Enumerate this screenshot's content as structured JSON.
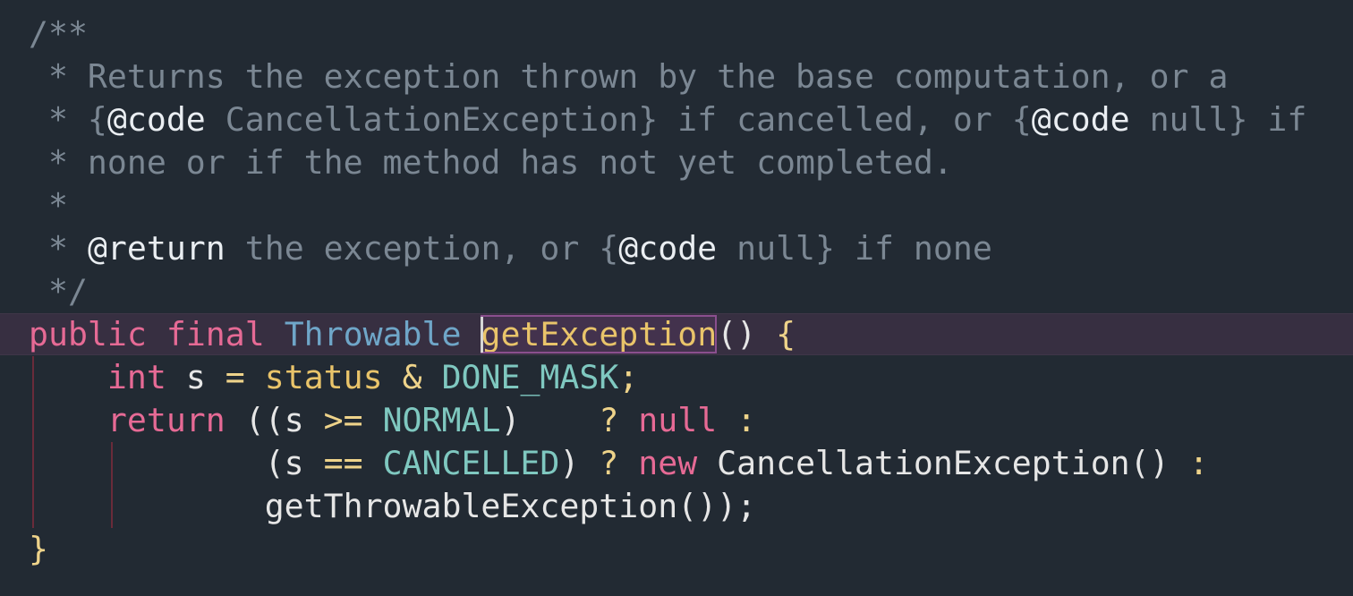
{
  "editor": {
    "lines": [
      {
        "tokens": [
          {
            "t": "/**",
            "c": "c"
          }
        ]
      },
      {
        "tokens": [
          {
            "t": " * Returns the exception thrown by the base computation, or a",
            "c": "c"
          }
        ]
      },
      {
        "tokens": [
          {
            "t": " * {",
            "c": "c"
          },
          {
            "t": "@code",
            "c": "tag"
          },
          {
            "t": " CancellationException} if cancelled, or {",
            "c": "c"
          },
          {
            "t": "@code",
            "c": "tag"
          },
          {
            "t": " null} if",
            "c": "c"
          }
        ]
      },
      {
        "tokens": [
          {
            "t": " * none or if the method has not yet completed.",
            "c": "c"
          }
        ]
      },
      {
        "tokens": [
          {
            "t": " *",
            "c": "c"
          }
        ]
      },
      {
        "tokens": [
          {
            "t": " * ",
            "c": "c"
          },
          {
            "t": "@return",
            "c": "tag"
          },
          {
            "t": " the exception, or {",
            "c": "c"
          },
          {
            "t": "@code",
            "c": "tag"
          },
          {
            "t": " null} if none",
            "c": "c"
          }
        ]
      },
      {
        "tokens": [
          {
            "t": " */",
            "c": "c"
          }
        ]
      },
      {
        "current": true,
        "tokens": [
          {
            "t": "public",
            "c": "kw"
          },
          {
            "t": " ",
            "c": "pl"
          },
          {
            "t": "final",
            "c": "kw"
          },
          {
            "t": " ",
            "c": "pl"
          },
          {
            "t": "Throwable",
            "c": "ty"
          },
          {
            "t": " ",
            "c": "pl"
          },
          {
            "t": "getException",
            "c": "fn",
            "match": true
          },
          {
            "t": "() ",
            "c": "pl"
          },
          {
            "t": "{",
            "c": "op"
          }
        ]
      },
      {
        "tokens": [
          {
            "t": "    ",
            "c": "pl"
          },
          {
            "t": "int",
            "c": "kw"
          },
          {
            "t": " s ",
            "c": "pl"
          },
          {
            "t": "=",
            "c": "op"
          },
          {
            "t": " ",
            "c": "pl"
          },
          {
            "t": "status",
            "c": "fn"
          },
          {
            "t": " ",
            "c": "pl"
          },
          {
            "t": "&",
            "c": "op"
          },
          {
            "t": " ",
            "c": "pl"
          },
          {
            "t": "DONE_MASK",
            "c": "cn"
          },
          {
            "t": ";",
            "c": "op"
          }
        ]
      },
      {
        "tokens": [
          {
            "t": "    ",
            "c": "pl"
          },
          {
            "t": "return",
            "c": "kw"
          },
          {
            "t": " ((s ",
            "c": "pl"
          },
          {
            "t": ">=",
            "c": "op"
          },
          {
            "t": " ",
            "c": "pl"
          },
          {
            "t": "NORMAL",
            "c": "cn"
          },
          {
            "t": ")    ",
            "c": "pl"
          },
          {
            "t": "?",
            "c": "op"
          },
          {
            "t": " ",
            "c": "pl"
          },
          {
            "t": "null",
            "c": "kw"
          },
          {
            "t": " ",
            "c": "pl"
          },
          {
            "t": ":",
            "c": "op"
          }
        ]
      },
      {
        "tokens": [
          {
            "t": "            (s ",
            "c": "pl"
          },
          {
            "t": "==",
            "c": "op"
          },
          {
            "t": " ",
            "c": "pl"
          },
          {
            "t": "CANCELLED",
            "c": "cn"
          },
          {
            "t": ") ",
            "c": "pl"
          },
          {
            "t": "?",
            "c": "op"
          },
          {
            "t": " ",
            "c": "pl"
          },
          {
            "t": "new",
            "c": "kw"
          },
          {
            "t": " CancellationException() ",
            "c": "pl"
          },
          {
            "t": ":",
            "c": "op"
          }
        ]
      },
      {
        "tokens": [
          {
            "t": "            getThrowableException());",
            "c": "pl"
          }
        ]
      },
      {
        "tokens": [
          {
            "t": "}",
            "c": "op"
          }
        ]
      }
    ]
  }
}
